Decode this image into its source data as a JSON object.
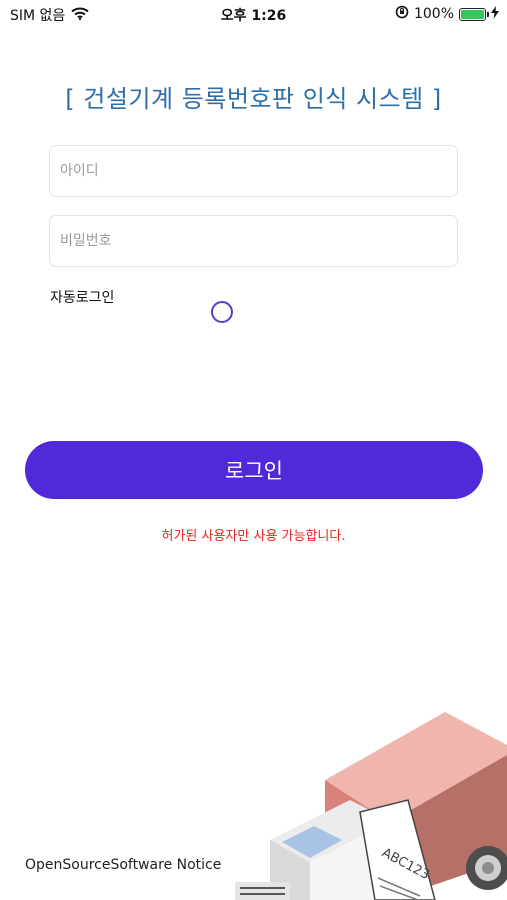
{
  "status_bar": {
    "carrier": "SIM 없음",
    "time": "오후 1:26",
    "battery_percent": "100%",
    "battery_level": 1.0,
    "icons": [
      "wifi-icon",
      "orientation-lock-icon",
      "battery-icon",
      "charging-icon"
    ]
  },
  "header": {
    "title": "[ 건설기계 등록번호판 인식 시스템 ]"
  },
  "login_form": {
    "id_placeholder": "아이디",
    "id_value": "",
    "password_placeholder": "비밀번호",
    "password_value": "",
    "auto_login_label": "자동로그인",
    "auto_login_checked": false,
    "login_button_label": "로그인",
    "notice_text": "허가된 사용자만 사용 가능합니다."
  },
  "footer": {
    "oss_notice": "OpenSourceSoftware Notice"
  },
  "illustration": {
    "plate_text": "ABC123",
    "name": "truck-illustration"
  },
  "colors": {
    "title": "#2e6fa8",
    "accent": "#5029d8",
    "notice": "#e8221d",
    "field_border": "#e3e3e3",
    "battery": "#34c759"
  }
}
